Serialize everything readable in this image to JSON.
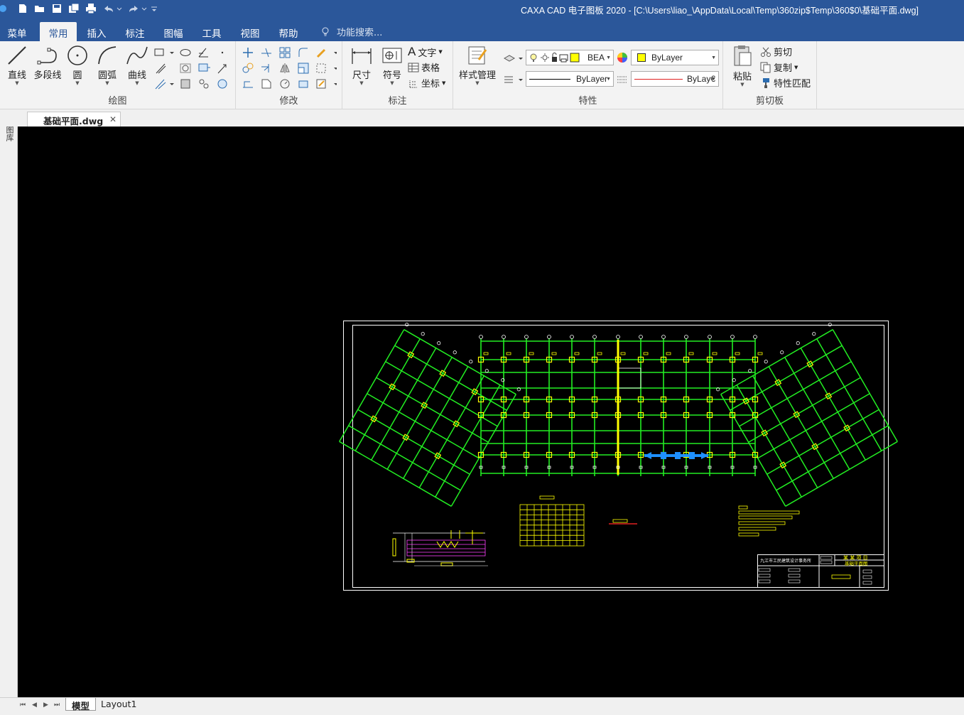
{
  "window": {
    "title": "CAXA CAD 电子图板 2020 - [C:\\Users\\liao_\\AppData\\Local\\Temp\\360zip$Temp\\360$0\\基础平面.dwg]"
  },
  "menu": {
    "tabs": [
      "菜单",
      "常用",
      "插入",
      "标注",
      "图幅",
      "工具",
      "视图",
      "帮助"
    ],
    "active_tab": "常用",
    "search_placeholder": "功能搜索..."
  },
  "ribbon": {
    "draw": {
      "label": "绘图",
      "line": "直线",
      "polyline": "多段线",
      "circle": "圆",
      "arc": "圆弧",
      "curve": "曲线"
    },
    "modify": {
      "label": "修改"
    },
    "annotate": {
      "label": "标注",
      "dimension": "尺寸",
      "symbol": "符号",
      "text": "文字",
      "table": "表格",
      "coordinate": "坐标"
    },
    "properties": {
      "label": "特性",
      "style_manager": "样式管理",
      "layer_value": "BEA",
      "color_value": "ByLayer",
      "linetype_value": "ByLayer",
      "lineweight_value": "ByLay€"
    },
    "clipboard": {
      "label": "剪切板",
      "paste": "粘贴",
      "cut": "剪切",
      "copy": "复制",
      "match_props": "特性匹配"
    }
  },
  "document": {
    "tab_name": "基础平面.dwg",
    "side_panel_label": "图库"
  },
  "layout_tabs": [
    "模型",
    "Layout1"
  ],
  "active_layout": "模型",
  "drawing": {
    "title_block_company": "九江市工民建筑设计事务所",
    "title_block_project": "某 某 项 目",
    "title_block_drawing": "基础平面图"
  },
  "colors": {
    "titlebar": "#2b579a",
    "canvas": "#000000",
    "grid_green": "#22ee22",
    "column_yellow": "#ffff00",
    "accent_blue": "#1e90ff"
  }
}
